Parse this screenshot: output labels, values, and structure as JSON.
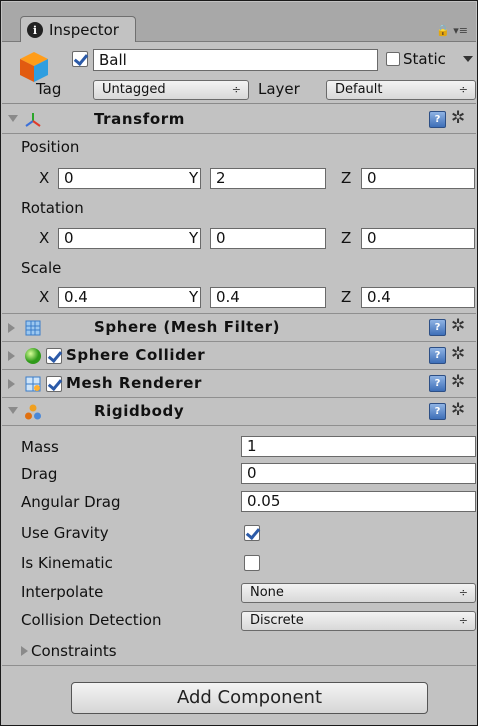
{
  "tab": {
    "title": "Inspector",
    "tools": "🔒 ▾≡"
  },
  "header": {
    "object_name": "Ball",
    "static_label": "Static",
    "tag_label": "Tag",
    "tag_value": "Untagged",
    "layer_label": "Layer",
    "layer_value": "Default",
    "active": true,
    "static": false
  },
  "transform": {
    "title": "Transform",
    "position_label": "Position",
    "rotation_label": "Rotation",
    "scale_label": "Scale",
    "axes": [
      "X",
      "Y",
      "Z"
    ],
    "position": [
      "0",
      "2",
      "0"
    ],
    "rotation": [
      "0",
      "0",
      "0"
    ],
    "scale": [
      "0.4",
      "0.4",
      "0.4"
    ]
  },
  "components": [
    {
      "title": "Sphere (Mesh Filter)",
      "icon": "mesh-filter-icon",
      "checkbox": false
    },
    {
      "title": "Sphere Collider",
      "icon": "sphere-collider-icon",
      "checkbox": true
    },
    {
      "title": "Mesh Renderer",
      "icon": "mesh-renderer-icon",
      "checkbox": true
    }
  ],
  "rigidbody": {
    "title": "Rigidbody",
    "mass_label": "Mass",
    "mass": "1",
    "drag_label": "Drag",
    "drag": "0",
    "angular_drag_label": "Angular Drag",
    "angular_drag": "0.05",
    "use_gravity_label": "Use Gravity",
    "use_gravity": true,
    "is_kinematic_label": "Is Kinematic",
    "is_kinematic": false,
    "interpolate_label": "Interpolate",
    "interpolate": "None",
    "collision_label": "Collision Detection",
    "collision": "Discrete",
    "constraints_label": "Constraints"
  },
  "add_component_label": "Add Component",
  "popup_arrow": "÷",
  "help_glyph": "?",
  "gear_glyph": "✲",
  "colors": {
    "panel": "#c2c2c2",
    "help_blue": "#3e6fb8",
    "check_blue": "#2b5aa8"
  }
}
